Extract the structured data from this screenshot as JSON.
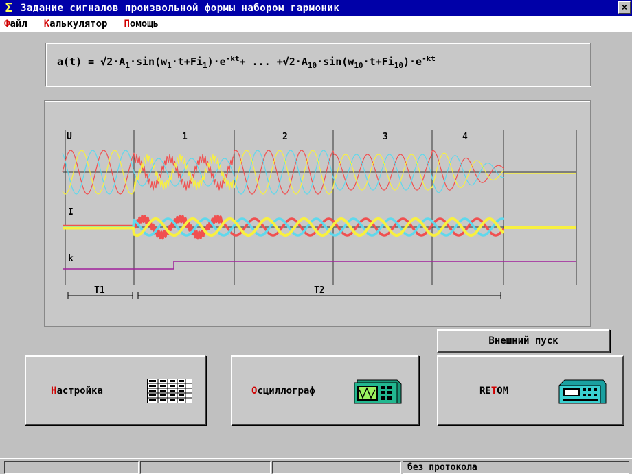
{
  "window": {
    "title": "Задание сигналов произвольной формы набором гармоник",
    "close_symbol": "×"
  },
  "menu": [
    {
      "hotkey": "Ф",
      "rest": "айл"
    },
    {
      "hotkey": "К",
      "rest": "алькулятор"
    },
    {
      "hotkey": "П",
      "rest": "омощь"
    }
  ],
  "formula": {
    "p1": "a(t) = √2·A",
    "s1": "1",
    "p2": "·sin(w",
    "s2": "1",
    "p3": "·t+Fi",
    "s3": "1",
    "p4": ")·e",
    "e1": "-kt",
    "p5": "+  ...  +√2·A",
    "s4": "10",
    "p6": "·sin(w",
    "s5": "10",
    "p7": "·t+Fi",
    "s6": "10",
    "p8": ")·e",
    "e2": "-kt"
  },
  "graph": {
    "signal_u": "U",
    "signal_i": "I",
    "signal_k": "k",
    "segments": [
      "1",
      "2",
      "3",
      "4"
    ],
    "t1": "T1",
    "t2": "T2",
    "colors": {
      "red": "#f05050",
      "cyan": "#5fd8ec",
      "yellow": "#f8f040",
      "k_line": "#a0209a",
      "axis": "#333333"
    }
  },
  "buttons": {
    "external_start": "Внешний пуск",
    "setup": {
      "hotkey": "Н",
      "rest": "астройка",
      "icon": "table-icon"
    },
    "oscillograph": {
      "hotkey": "О",
      "rest": "сциллограф",
      "icon": "oscilloscope-icon"
    },
    "retom": {
      "pre": "RE",
      "hotkey": "T",
      "post": "OM",
      "icon": "retom-device-icon"
    }
  },
  "status": [
    "",
    "",
    "",
    "без протокола"
  ]
}
